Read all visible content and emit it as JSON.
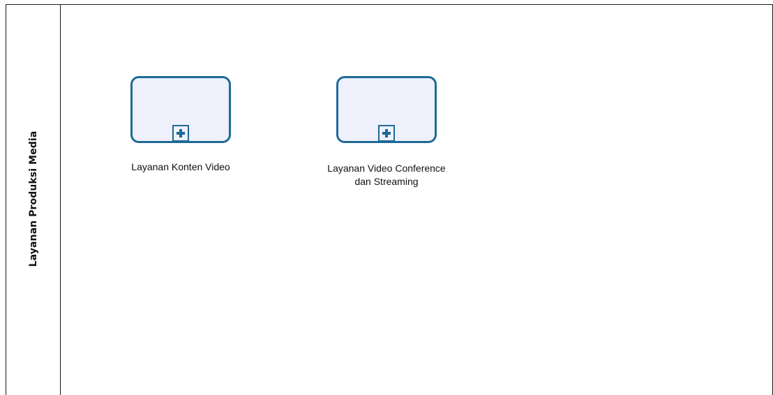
{
  "lane": {
    "label": "Layanan Produksi Media"
  },
  "tasks": [
    {
      "label": "Layanan Konten Video",
      "marker": "plus-icon"
    },
    {
      "label": "Layanan Video Conference dan Streaming",
      "label_line1": "Layanan Video Conference",
      "label_line2": "dan Streaming",
      "marker": "plus-icon"
    }
  ],
  "colors": {
    "task_border": "#1d6a96",
    "task_fill": "#eef0fc",
    "lines": "#1a1a1a"
  }
}
